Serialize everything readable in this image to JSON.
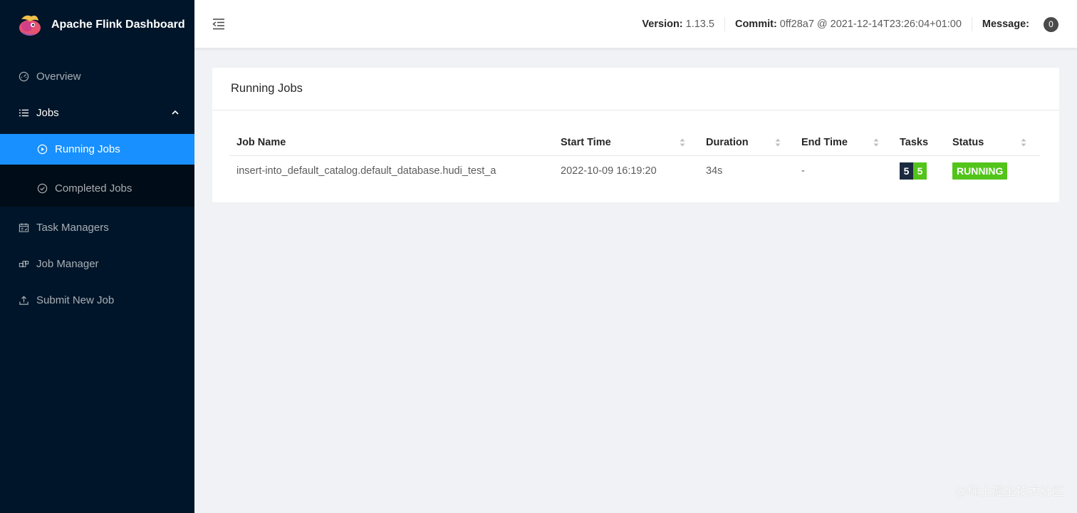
{
  "app": {
    "title": "Apache Flink Dashboard"
  },
  "sidebar": {
    "items": [
      {
        "label": "Overview",
        "icon": "dashboard-icon"
      },
      {
        "label": "Jobs",
        "icon": "list-icon",
        "expanded": true,
        "children": [
          {
            "label": "Running Jobs",
            "icon": "play-circle-icon",
            "active": true
          },
          {
            "label": "Completed Jobs",
            "icon": "check-circle-icon"
          }
        ]
      },
      {
        "label": "Task Managers",
        "icon": "schedule-icon"
      },
      {
        "label": "Job Manager",
        "icon": "cluster-icon"
      },
      {
        "label": "Submit New Job",
        "icon": "upload-icon"
      }
    ]
  },
  "header": {
    "version_label": "Version:",
    "version_value": "1.13.5",
    "commit_label": "Commit:",
    "commit_value": "0ff28a7 @ 2021-12-14T23:26:04+01:00",
    "message_label": "Message:",
    "message_count": "0"
  },
  "card": {
    "title": "Running Jobs",
    "columns": [
      "Job Name",
      "Start Time",
      "Duration",
      "End Time",
      "Tasks",
      "Status"
    ],
    "rows": [
      {
        "job_name": "insert-into_default_catalog.default_database.hudi_test_a",
        "start_time": "2022-10-09 16:19:20",
        "duration": "34s",
        "end_time": "-",
        "tasks_total": "5",
        "tasks_running": "5",
        "status": "RUNNING"
      }
    ]
  },
  "colors": {
    "sidebar_bg": "#001529",
    "active": "#1890ff",
    "running": "#52c41a",
    "task_total": "#1b2a3f"
  },
  "watermark": "@稀土掘金技术社区"
}
